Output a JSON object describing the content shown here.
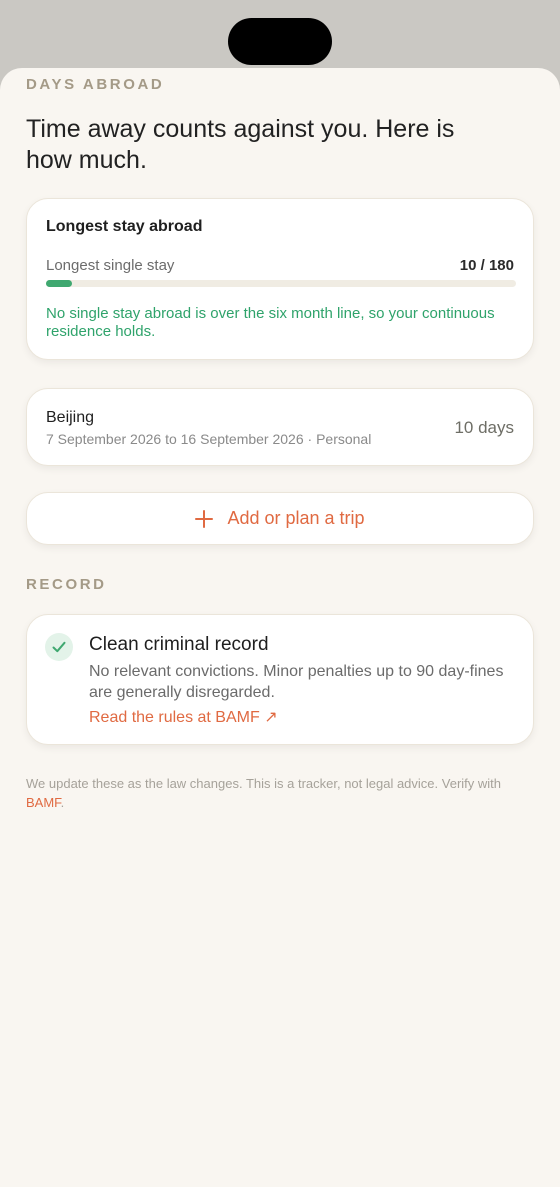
{
  "days_abroad": {
    "section_label": "DAYS ABROAD",
    "headline": "Time away counts against you. Here is how much.",
    "longest_stay_card": {
      "title": "Longest stay abroad",
      "metric_label": "Longest single stay",
      "metric_value": "10 / 180",
      "progress_fraction": 0.056,
      "note": "No single stay abroad is over the six month line, so your continuous residence holds."
    },
    "trip": {
      "destination": "Beijing",
      "details": "7 September 2026 to 16 September 2026 · Personal",
      "duration": "10 days"
    },
    "add_trip_label": "Add or plan a trip"
  },
  "record": {
    "section_label": "RECORD",
    "title": "Clean criminal record",
    "description": "No relevant convictions. Minor penalties up to 90 day-fines are generally disregarded.",
    "link_label": "Read the rules at BAMF ↗"
  },
  "footer": {
    "text": "We update these as the law changes. This is a tracker, not legal advice. Verify with ",
    "link": "BAMF",
    "end": "."
  },
  "colors": {
    "accent": "#e06a42",
    "success": "#3fa870",
    "background": "#f9f6f1"
  }
}
